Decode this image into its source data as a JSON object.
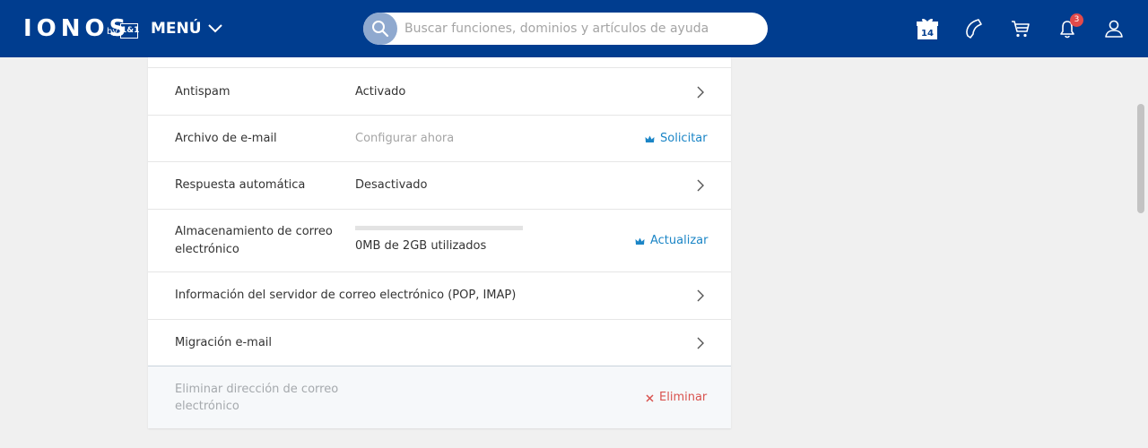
{
  "header": {
    "logo": "IONOS",
    "logo_by": "by",
    "logo_brand": "1&1",
    "menu_label": "MENÚ",
    "search_placeholder": "Buscar funciones, dominios y artículos de ayuda",
    "gift_number": "14",
    "notification_count": "3",
    "icons": [
      "gift-icon",
      "phone-icon",
      "cart-icon",
      "bell-icon",
      "user-icon"
    ]
  },
  "settings": {
    "antispam": {
      "label": "Antispam",
      "value": "Activado"
    },
    "archive": {
      "label": "Archivo de e-mail",
      "value": "Configurar ahora",
      "action": "Solicitar"
    },
    "autoreply": {
      "label": "Respuesta automática",
      "value": "Desactivado"
    },
    "storage": {
      "label_line1": "Almacenamiento de correo",
      "label_line2": "electrónico",
      "value": "0MB de 2GB utilizados",
      "used_fraction": 0,
      "action": "Actualizar"
    },
    "server_info": {
      "label": "Información del servidor de correo electrónico (POP, IMAP)"
    },
    "migration": {
      "label": "Migración e-mail"
    },
    "delete": {
      "label_line1": "Eliminar dirección de correo",
      "label_line2": "electrónico",
      "action": "Eliminar"
    }
  },
  "colors": {
    "header_bg": "#003d8f",
    "link_blue": "#1b85c6",
    "danger_red": "#d9534f",
    "badge_red": "#e24a4a"
  }
}
